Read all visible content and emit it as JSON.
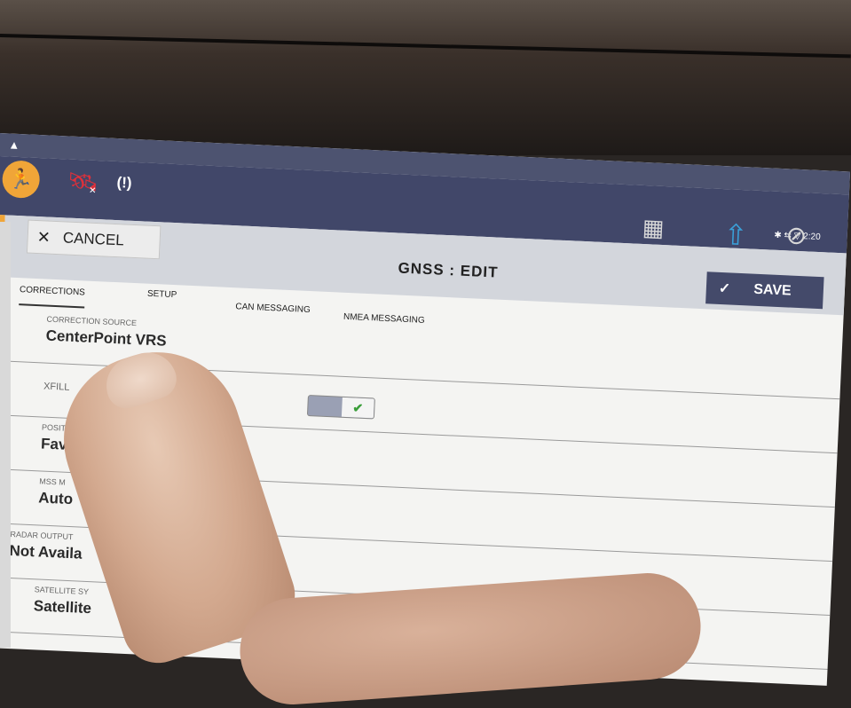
{
  "statusbar": {
    "time": "2:20",
    "icons": [
      "warning-icon",
      "bluetooth-icon",
      "signal-icon",
      "wifi-icon"
    ]
  },
  "appbar": {
    "left_icons": [
      "run-icon",
      "satellite-disconnected-icon",
      "radio-signal-icon"
    ],
    "right_icons": [
      "field-no-boundary-icon",
      "upload-vehicle-icon",
      "steering-disabled-icon"
    ],
    "signal_text": "(!)"
  },
  "editor": {
    "cancel_label": "CANCEL",
    "title": "GNSS : EDIT",
    "save_label": "SAVE"
  },
  "tabs": [
    {
      "label": "CORRECTIONS",
      "active": true
    },
    {
      "label": "SETUP",
      "active": false
    },
    {
      "label": "CAN MESSAGING",
      "active": false
    },
    {
      "label": "NMEA MESSAGING",
      "active": false
    }
  ],
  "rows": [
    {
      "label": "CORRECTION SOURCE",
      "value": "CenterPoint VRS"
    },
    {
      "label": "XFILL",
      "value": "",
      "toggle": true,
      "toggle_on": true
    },
    {
      "label": "POSIT",
      "value": "Favo"
    },
    {
      "label": "MSS M",
      "value": "Auto"
    },
    {
      "label": "RADAR OUTPUT",
      "value": "Not Availa"
    },
    {
      "label": "SATELLITE SY",
      "value": "Satellite"
    }
  ],
  "colors": {
    "header": "#414769",
    "accent": "#f0a538",
    "save": "#444a6a",
    "toggle_check": "#3a9e3a"
  }
}
